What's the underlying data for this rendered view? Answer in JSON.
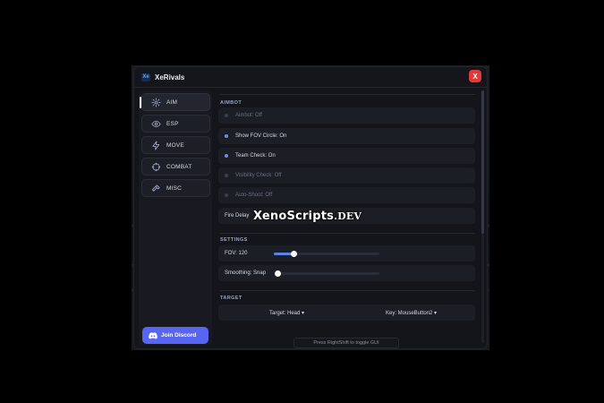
{
  "window": {
    "title": "XeRivals",
    "logo_text": "Xe",
    "close_label": "X"
  },
  "sidebar": {
    "items": [
      {
        "label": "AIM",
        "icon": "gear-icon",
        "active": true
      },
      {
        "label": "ESP",
        "icon": "eye-icon",
        "active": false
      },
      {
        "label": "MOVE",
        "icon": "lightning-icon",
        "active": false
      },
      {
        "label": "COMBAT",
        "icon": "crosshair-icon",
        "active": false
      },
      {
        "label": "MISC",
        "icon": "hammer-icon",
        "active": false
      }
    ],
    "discord_label": "Join Discord"
  },
  "aimbot": {
    "section_title": "AIMBOT",
    "toggles": [
      {
        "label": "Aimbot: Off",
        "state": "off"
      },
      {
        "label": "Show FOV Circle: On",
        "state": "on"
      },
      {
        "label": "Team Check: On",
        "state": "on"
      },
      {
        "label": "Visibility Check: Off",
        "state": "off"
      },
      {
        "label": "Auto-Shoot: Off",
        "state": "off"
      }
    ],
    "fire_delay_label": "Fire Delay"
  },
  "settings": {
    "section_title": "SETTINGS",
    "fov_label": "FOV: 120",
    "fov_fill_fraction": 0.19,
    "smoothing_label": "Smoothing: Snap",
    "smoothing_fill_fraction": 0.0
  },
  "target": {
    "section_title": "TARGET",
    "target_label": "Target: Head ▾",
    "key_label": "Key: MouseButton2 ▾"
  },
  "hint": "Press RightShift to toggle GUI",
  "watermark": {
    "main": "XenoScripts",
    "suffix": ".DEV"
  },
  "colors": {
    "accent": "#5b82e6",
    "discord": "#5865f2",
    "close": "#e0383b",
    "background": "#14151b"
  }
}
